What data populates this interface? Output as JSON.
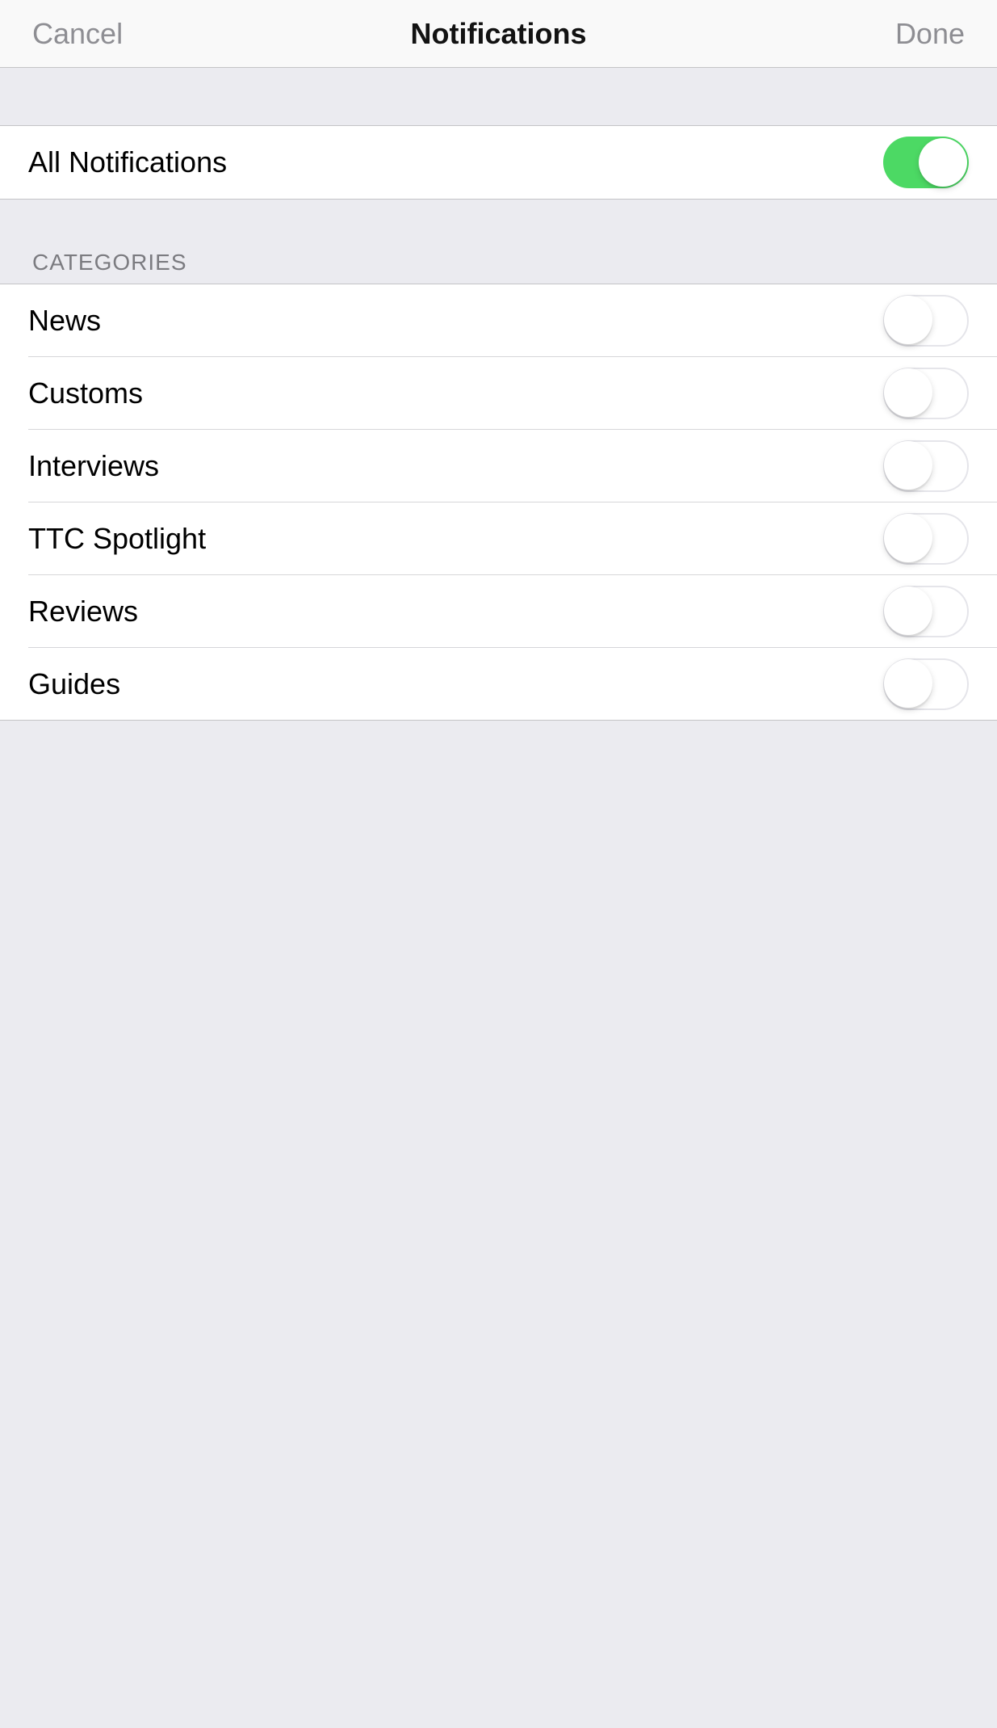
{
  "navbar": {
    "cancel": "Cancel",
    "title": "Notifications",
    "done": "Done"
  },
  "main_toggle": {
    "label": "All Notifications",
    "enabled": true
  },
  "section_header": "CATEGORIES",
  "categories": [
    {
      "label": "News",
      "enabled": false
    },
    {
      "label": "Customs",
      "enabled": false
    },
    {
      "label": "Interviews",
      "enabled": false
    },
    {
      "label": "TTC Spotlight",
      "enabled": false
    },
    {
      "label": "Reviews",
      "enabled": false
    },
    {
      "label": "Guides",
      "enabled": false
    }
  ],
  "colors": {
    "toggle_on": "#4cd964",
    "background": "#ebebf0"
  }
}
